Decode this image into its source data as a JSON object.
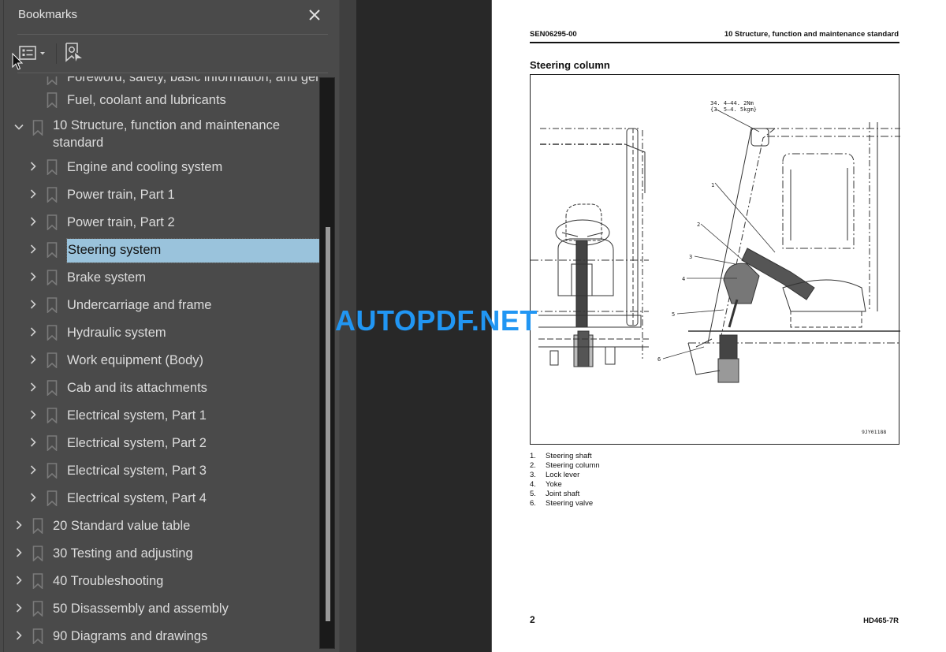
{
  "bookmarks_panel": {
    "title": "Bookmarks",
    "close_icon": "close-icon",
    "toolbar": {
      "options_icon": "list-options-icon",
      "find_icon": "find-current-bookmark-icon"
    },
    "items": [
      {
        "label": "Foreword, safety, basic information, and general",
        "level": 1,
        "expander": "none",
        "partial": true
      },
      {
        "label": "Fuel, coolant and lubricants",
        "level": 1,
        "expander": "none"
      },
      {
        "label": "10 Structure, function and maintenance standard",
        "level": 0,
        "expander": "expanded"
      },
      {
        "label": "Engine and cooling system",
        "level": 1,
        "expander": "collapsed"
      },
      {
        "label": "Power train, Part 1",
        "level": 1,
        "expander": "collapsed"
      },
      {
        "label": "Power train, Part 2",
        "level": 1,
        "expander": "collapsed"
      },
      {
        "label": "Steering system",
        "level": 1,
        "expander": "collapsed",
        "selected": true
      },
      {
        "label": "Brake system",
        "level": 1,
        "expander": "collapsed"
      },
      {
        "label": "Undercarriage and frame",
        "level": 1,
        "expander": "collapsed"
      },
      {
        "label": "Hydraulic system",
        "level": 1,
        "expander": "collapsed"
      },
      {
        "label": "Work equipment (Body)",
        "level": 1,
        "expander": "collapsed"
      },
      {
        "label": "Cab and its attachments",
        "level": 1,
        "expander": "collapsed"
      },
      {
        "label": "Electrical system, Part 1",
        "level": 1,
        "expander": "collapsed"
      },
      {
        "label": "Electrical system, Part 2",
        "level": 1,
        "expander": "collapsed"
      },
      {
        "label": "Electrical system, Part 3",
        "level": 1,
        "expander": "collapsed"
      },
      {
        "label": "Electrical system, Part 4",
        "level": 1,
        "expander": "collapsed"
      },
      {
        "label": "20 Standard value table",
        "level": 0,
        "expander": "collapsed"
      },
      {
        "label": "30 Testing and adjusting",
        "level": 0,
        "expander": "collapsed"
      },
      {
        "label": "40 Troubleshooting",
        "level": 0,
        "expander": "collapsed"
      },
      {
        "label": "50 Disassembly and assembly",
        "level": 0,
        "expander": "collapsed"
      },
      {
        "label": "90 Diagrams and drawings",
        "level": 0,
        "expander": "collapsed"
      }
    ],
    "scroll": {
      "thumb_start_fraction": 0.26,
      "thumb_end_fraction": 0.95
    }
  },
  "document": {
    "doc_id": "SEN06295-00",
    "section": "10 Structure, function and maintenance standard",
    "figure_title": "Steering column",
    "figure": {
      "torque_note_line1": "34. 4–44. 2Nm",
      "torque_note_line2": "{3. 5–4. 5kgm}",
      "figure_code": "9JY01188",
      "callouts": [
        "1",
        "2",
        "3",
        "4",
        "5",
        "6"
      ]
    },
    "legend": [
      {
        "num": "1.",
        "text": "Steering shaft"
      },
      {
        "num": "2.",
        "text": "Steering column"
      },
      {
        "num": "3.",
        "text": "Lock lever"
      },
      {
        "num": "4.",
        "text": "Yoke"
      },
      {
        "num": "5.",
        "text": "Joint shaft"
      },
      {
        "num": "6.",
        "text": "Steering valve"
      }
    ],
    "page_number": "2",
    "model": "HD465-7R"
  },
  "watermark": {
    "text": "AUTOPDF.NET",
    "color": "#2196f3"
  },
  "colors": {
    "panel_bg": "#4a4a4a",
    "selection_bg": "#9ac3dc",
    "viewer_bg": "#282828",
    "page_bg": "#ffffff"
  }
}
